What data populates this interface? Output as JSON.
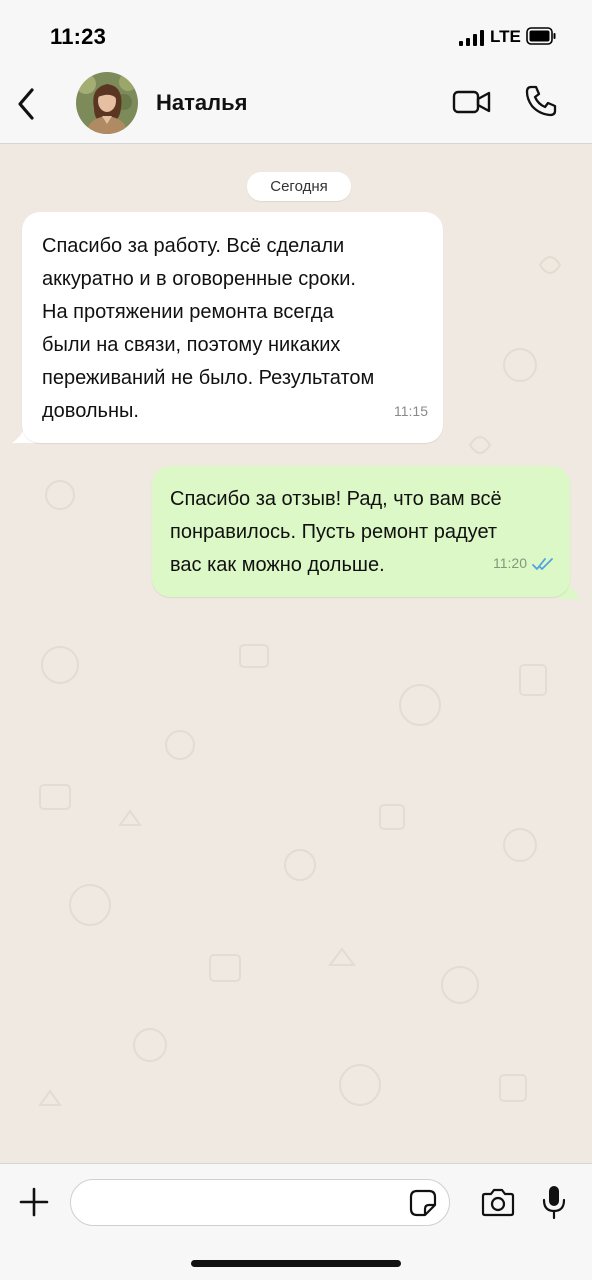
{
  "status_bar": {
    "time": "11:23",
    "network": "LTE",
    "signal_icon": "signal-bars-icon",
    "battery_icon": "battery-icon"
  },
  "header": {
    "back_icon": "chevron-left-icon",
    "contact_name": "Наталья",
    "video_icon": "video-camera-icon",
    "call_icon": "phone-icon"
  },
  "chat": {
    "date_label": "Сегодня",
    "messages": [
      {
        "direction": "incoming",
        "text": "Спасибо за работу. Всё сделали\nаккуратно и в оговоренные сроки.\nНа протяжении ремонта всегда\nбыли на связи, поэтому никаких\nпереживаний не было. Результатом\nдовольны.",
        "time": "11:15"
      },
      {
        "direction": "outgoing",
        "text": "Спасибо за отзыв! Рад, что вам всё\nпонравилось. Пусть ремонт радует\nвас как можно дольше.",
        "time": "11:20",
        "status_icon": "double-check-icon"
      }
    ]
  },
  "input_bar": {
    "plus_icon": "plus-icon",
    "message_value": "",
    "message_placeholder": "",
    "sticker_icon": "sticker-icon",
    "camera_icon": "camera-icon",
    "mic_icon": "microphone-icon"
  },
  "colors": {
    "chat_background": "#efe9e1",
    "incoming_bubble": "#ffffff",
    "outgoing_bubble": "#dcf8c6",
    "read_receipt": "#4fa3e0"
  }
}
